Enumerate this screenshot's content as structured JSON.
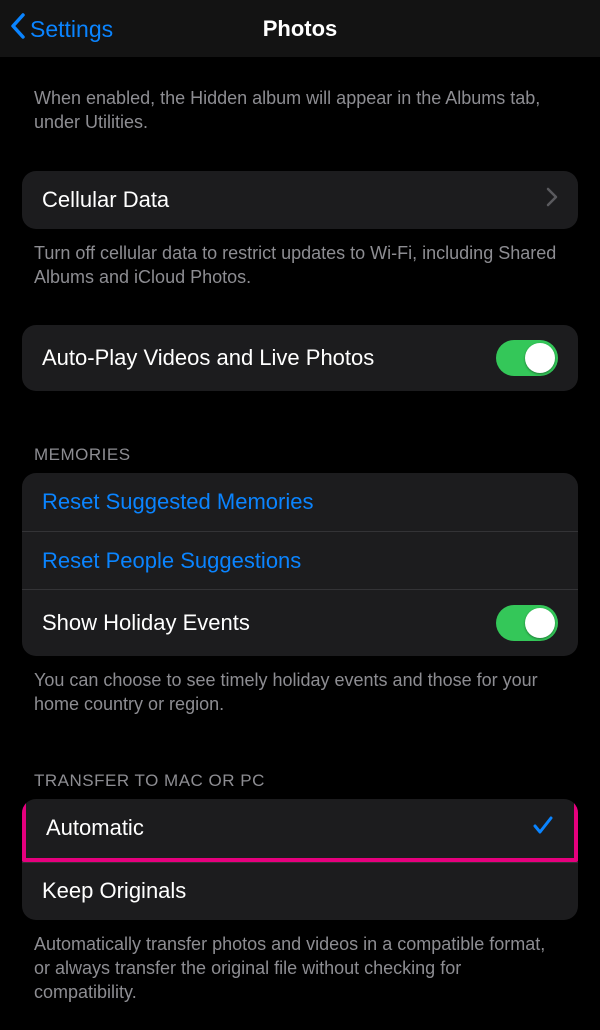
{
  "nav": {
    "back": "Settings",
    "title": "Photos"
  },
  "hidden_footer": "When enabled, the Hidden album will appear in the Albums tab, under Utilities.",
  "cellular": {
    "label": "Cellular Data",
    "footer": "Turn off cellular data to restrict updates to Wi-Fi, including Shared Albums and iCloud Photos."
  },
  "autoplay": {
    "label": "Auto-Play Videos and Live Photos",
    "on": true
  },
  "memories": {
    "header": "MEMORIES",
    "reset_suggested": "Reset Suggested Memories",
    "reset_people": "Reset People Suggestions",
    "show_holiday": "Show Holiday Events",
    "show_holiday_on": true,
    "footer": "You can choose to see timely holiday events and those for your home country or region."
  },
  "transfer": {
    "header": "TRANSFER TO MAC OR PC",
    "automatic": "Automatic",
    "keep_originals": "Keep Originals",
    "selected": "automatic",
    "footer": "Automatically transfer photos and videos in a compatible format, or always transfer the original file without checking for compatibility."
  }
}
